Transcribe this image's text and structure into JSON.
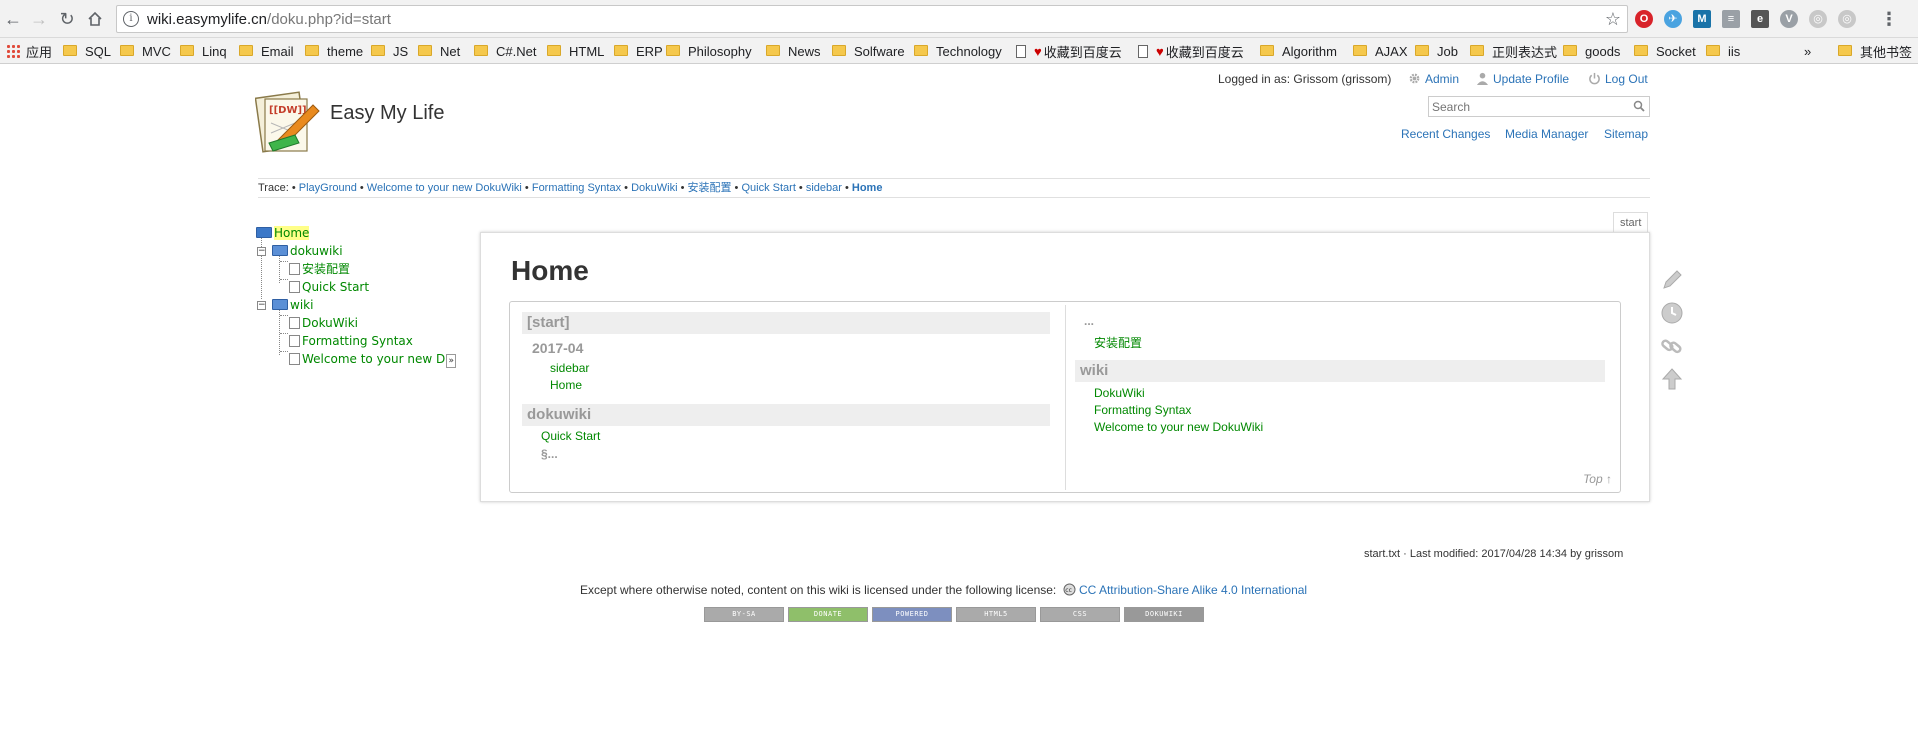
{
  "browser": {
    "url_host": "wiki.easymylife.cn",
    "url_path": "/doku.php?id=start",
    "bookmarks": [
      "应用",
      "SQL",
      "MVC",
      "Linq",
      "Email",
      "theme",
      "JS",
      "Net",
      "C#.Net",
      "HTML",
      "ERP",
      "Philosophy",
      "News",
      "Solfware",
      "Technology",
      "收藏到百度云",
      "收藏到百度云",
      "Algorithm",
      "AJAX",
      "Job",
      "正则表达式",
      "goods",
      "Socket",
      "iis",
      "»",
      "其他书签"
    ]
  },
  "site": {
    "title": "Easy My Life",
    "logged_in_text": "Logged in as: Grissom (grissom)",
    "admin": "Admin",
    "update_profile": "Update Profile",
    "logout": "Log Out",
    "search_placeholder": "Search",
    "recent_changes": "Recent Changes",
    "media_manager": "Media Manager",
    "sitemap": "Sitemap"
  },
  "trace": {
    "label": "Trace:",
    "items": [
      "PlayGround",
      "Welcome to your new DokuWiki",
      "Formatting Syntax",
      "DokuWiki",
      "安装配置",
      "Quick Start",
      "sidebar"
    ],
    "current": "Home"
  },
  "sidebar_tree": {
    "home": "Home",
    "dokuwiki": "dokuwiki",
    "dokuwiki_children": [
      "安装配置",
      "Quick Start"
    ],
    "wiki": "wiki",
    "wiki_children": [
      "DokuWiki",
      "Formatting Syntax",
      "Welcome to your new D"
    ],
    "more": "»"
  },
  "page": {
    "tab": "start",
    "heading": "Home",
    "left_col": {
      "start_head": "[start]",
      "year": "2017-04",
      "year_items": [
        "sidebar",
        "Home"
      ],
      "dokuwiki_head": "dokuwiki",
      "dokuwiki_items": [
        "Quick Start"
      ],
      "more": "§..."
    },
    "right_col": {
      "ellipsis": "...",
      "top_item": "安装配置",
      "wiki_head": "wiki",
      "wiki_items": [
        "DokuWiki",
        "Formatting Syntax",
        "Welcome to your new DokuWiki"
      ]
    },
    "top_link": "Top ↑"
  },
  "footer": {
    "docinfo": "start.txt · Last modified: 2017/04/28 14:34 by grissom",
    "license_text": "Except where otherwise noted, content on this wiki is licensed under the following license:",
    "license_link": "CC Attribution-Share Alike 4.0 International",
    "badges": [
      "BY-SA",
      "DONATE",
      "POWERED",
      "HTML5",
      "CSS",
      "DOKUWIKI"
    ]
  },
  "colors": {
    "link": "#2b73b7",
    "wiki_link": "#008800",
    "highlight": "#ffff88"
  }
}
